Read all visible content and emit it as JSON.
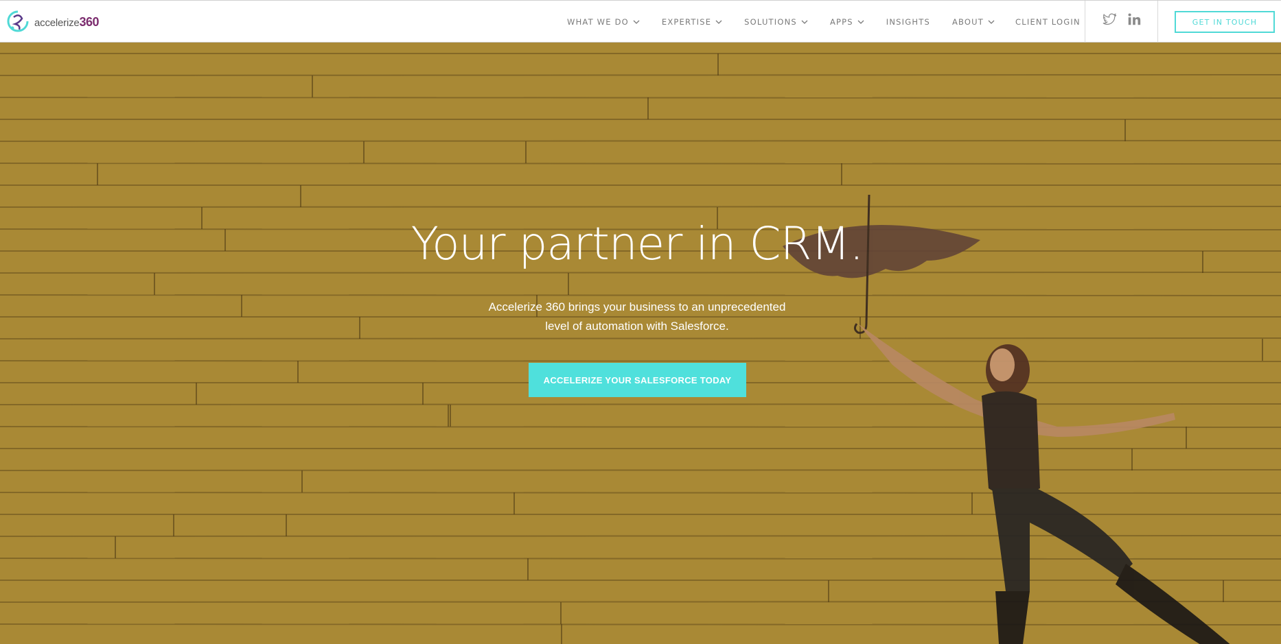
{
  "brand": {
    "name": "accelerize",
    "number": "360",
    "colors": {
      "accent": "#4fd9d6",
      "brand_purple": "#7b2c6e",
      "hero_bg": "#b89539"
    }
  },
  "nav": {
    "items": [
      {
        "label": "WHAT WE DO",
        "dropdown": true
      },
      {
        "label": "EXPERTISE",
        "dropdown": true
      },
      {
        "label": "SOLUTIONS",
        "dropdown": true
      },
      {
        "label": "APPS",
        "dropdown": true
      },
      {
        "label": "INSIGHTS",
        "dropdown": false
      },
      {
        "label": "ABOUT",
        "dropdown": true
      },
      {
        "label": "CLIENT LOGIN",
        "dropdown": false
      }
    ],
    "social": [
      {
        "icon": "twitter-icon"
      },
      {
        "icon": "linkedin-icon"
      }
    ],
    "cta_label": "GET IN TOUCH"
  },
  "hero": {
    "title": "Your partner in CRM.",
    "subtitle_line1": "Accelerize 360 brings your business to an unprecedented",
    "subtitle_line2": "level of automation with Salesforce.",
    "button_label": "ACCELERIZE YOUR SALESFORCE TODAY"
  }
}
